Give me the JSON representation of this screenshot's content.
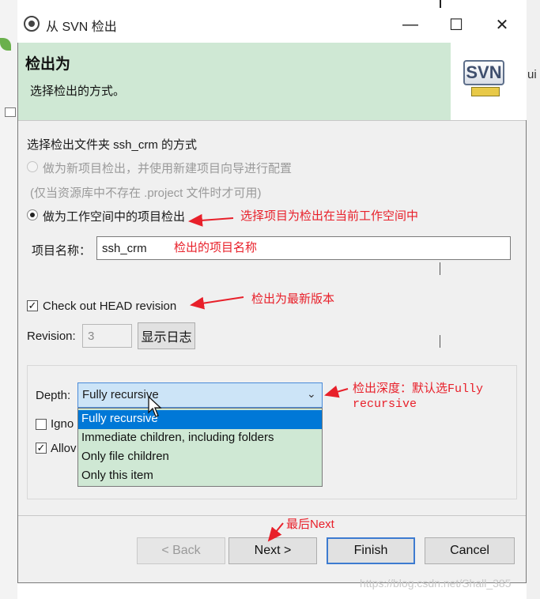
{
  "window": {
    "title": "从 SVN 检出",
    "minimize_icon": "minimize-icon",
    "maximize_icon": "maximize-icon",
    "close_icon": "close-icon"
  },
  "banner": {
    "title": "检出为",
    "description": "选择检出的方式。",
    "logo_text": "SVN"
  },
  "section_label": "选择检出文件夹 ssh_crm 的方式",
  "options": {
    "new_project": "做为新项目检出，并使用新建项目向导进行配置",
    "new_project_note": "(仅当资源库中不存在 .project 文件时才可用)",
    "workspace_project": "做为工作空间中的项目检出"
  },
  "project_name": {
    "label": "项目名称：",
    "value": "ssh_crm"
  },
  "head_revision": {
    "label": "Check out HEAD revision",
    "checked": true
  },
  "revision": {
    "label": "Revision:",
    "value": "3",
    "show_log_button": "显示日志"
  },
  "depth": {
    "label": "Depth:",
    "selected": "Fully recursive",
    "options": [
      "Fully recursive",
      "Immediate children, including folders",
      "Only file children",
      "Only this item"
    ]
  },
  "hidden_checkboxes": {
    "ignore_label": "Igno",
    "allow_label": "Allov"
  },
  "buttons": {
    "back": "< Back",
    "next": "Next >",
    "finish": "Finish",
    "cancel": "Cancel"
  },
  "annotations": {
    "workspace": "选择项目为检出在当前工作空间中",
    "project_name": "检出的项目名称",
    "head": "检出为最新版本",
    "depth_line1": "检出深度：默认选Fully",
    "depth_line2": "recursive",
    "next": "最后Next"
  },
  "background": {
    "right_text": "ui"
  },
  "watermark": "https://blog.csdn.net/Shall_385",
  "colors": {
    "banner": "#cfe8d4",
    "annotation": "#e8202a",
    "selection": "#0078d7",
    "default_button_border": "#3d7bd0"
  }
}
